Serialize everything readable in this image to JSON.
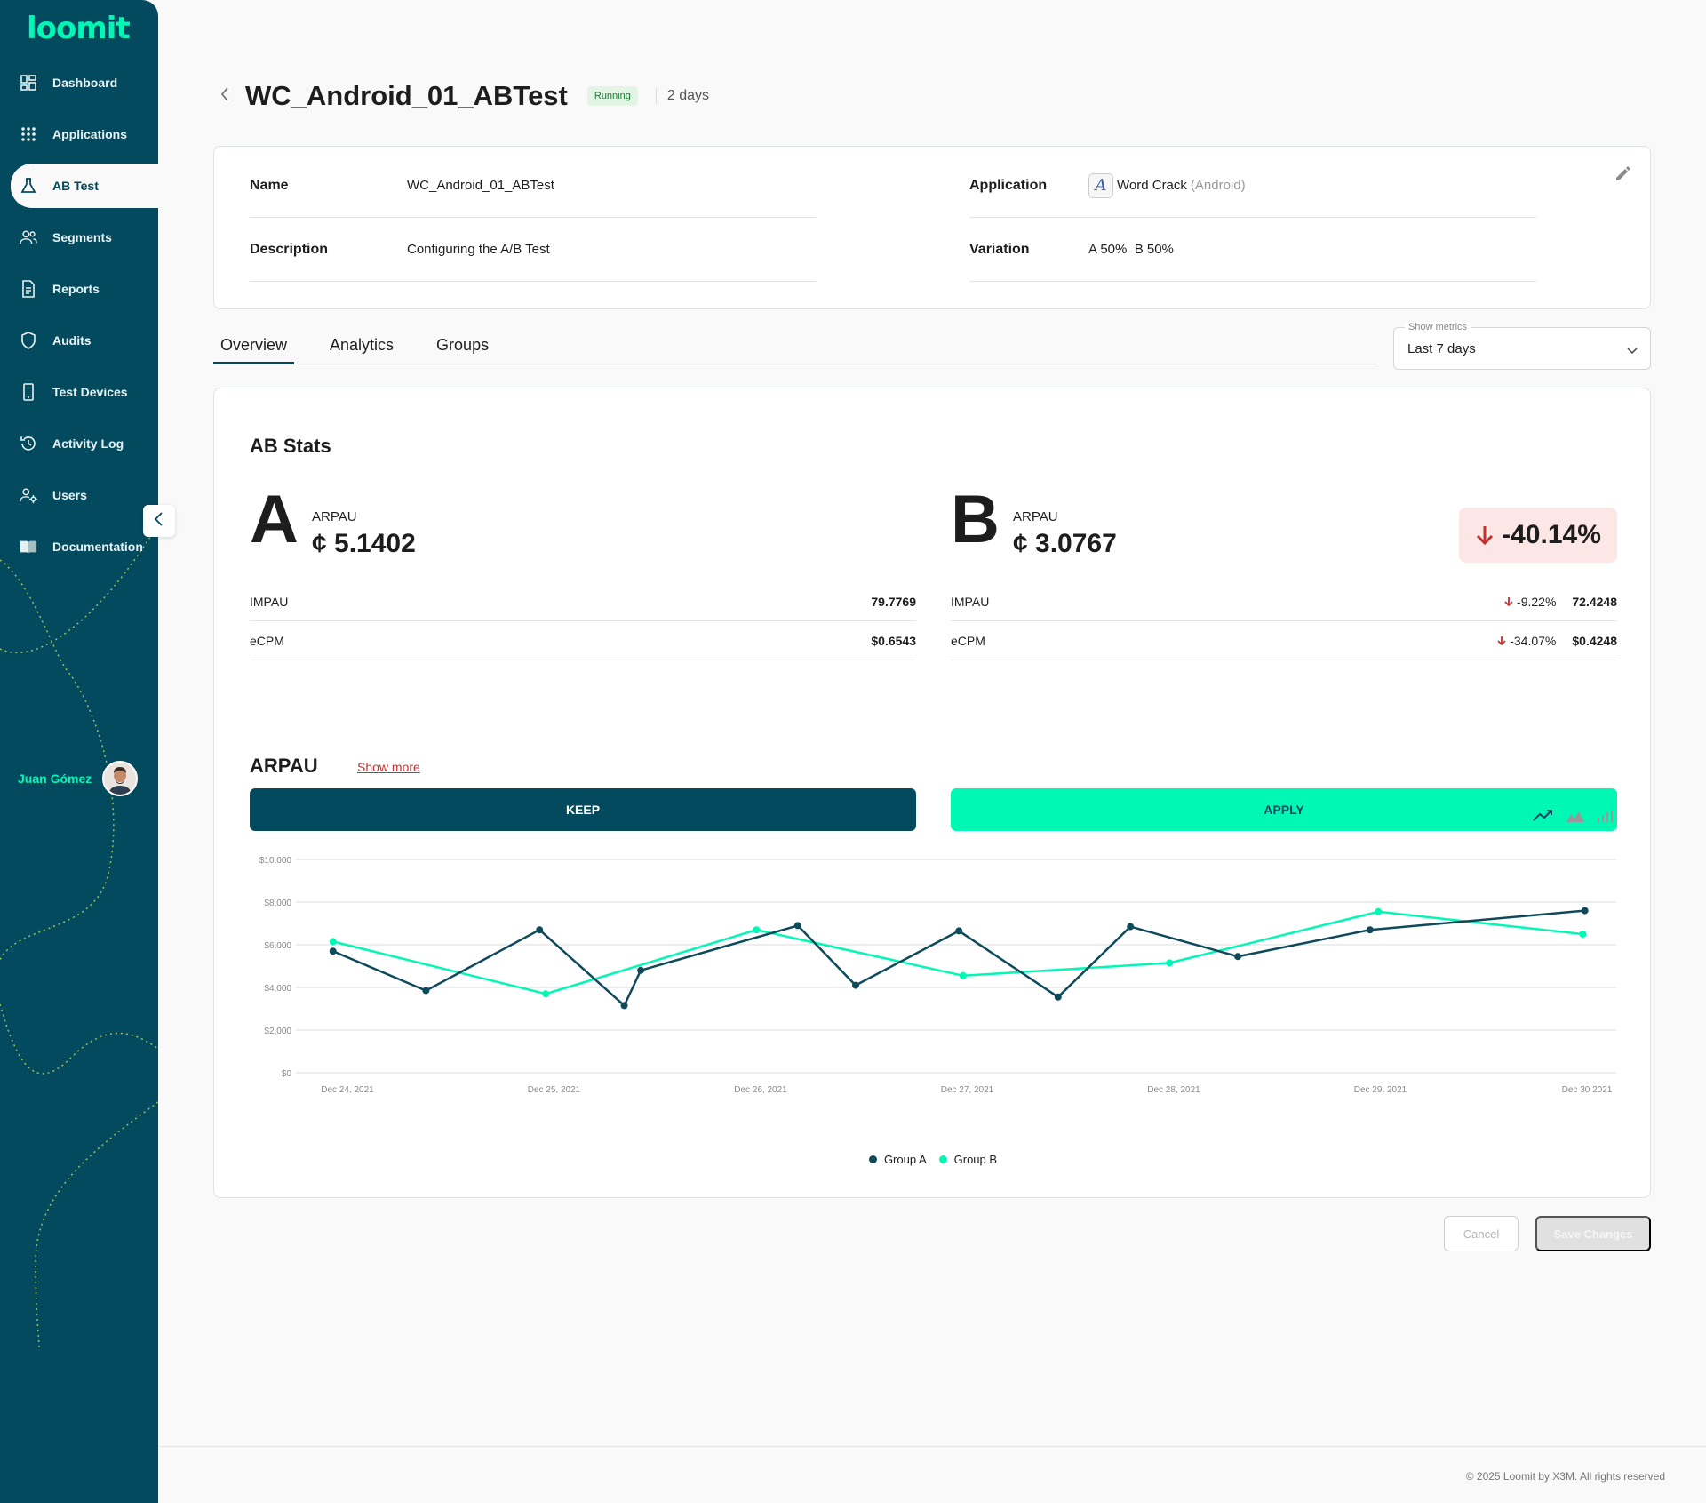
{
  "app": {
    "logo": "loomit"
  },
  "sidebar": {
    "items": [
      {
        "label": "Dashboard",
        "icon": "dashboard-icon"
      },
      {
        "label": "Applications",
        "icon": "apps-grid-icon"
      },
      {
        "label": "AB Test",
        "icon": "flask-icon",
        "active": true
      },
      {
        "label": "Segments",
        "icon": "users-group-icon"
      },
      {
        "label": "Reports",
        "icon": "document-icon"
      },
      {
        "label": "Audits",
        "icon": "shield-icon"
      },
      {
        "label": "Test Devices",
        "icon": "phone-icon"
      },
      {
        "label": "Activity Log",
        "icon": "history-icon"
      },
      {
        "label": "Users",
        "icon": "user-settings-icon"
      },
      {
        "label": "Documentation",
        "icon": "book-icon"
      }
    ],
    "user": {
      "name": "Juan Gómez"
    },
    "colors": {
      "background": "#044a5f",
      "accent": "#00f7b4"
    }
  },
  "header": {
    "title": "WC_Android_01_ABTest",
    "status": "Running",
    "duration": "2 days"
  },
  "info": {
    "name_label": "Name",
    "name_value": "WC_Android_01_ABTest",
    "description_label": "Description",
    "description_value": "Configuring the A/B Test",
    "application_label": "Application",
    "application_name": "Word Crack",
    "application_platform": "(Android)",
    "variation_label": "Variation",
    "variation_value": "A 50%  B 50%"
  },
  "tabs": [
    "Overview",
    "Analytics",
    "Groups"
  ],
  "metrics_select": {
    "label": "Show metrics",
    "value": "Last 7 days"
  },
  "stats": {
    "title": "AB Stats",
    "group_a": {
      "letter": "A",
      "arpau_label": "ARPAU",
      "arpau_value": "¢ 5.1402",
      "metrics": [
        {
          "label": "IMPAU",
          "value": "79.7769"
        },
        {
          "label": "eCPM",
          "value": "$0.6543"
        }
      ],
      "button": "KEEP"
    },
    "group_b": {
      "letter": "B",
      "arpau_label": "ARPAU",
      "arpau_value": "¢ 3.0767",
      "delta": "-40.14%",
      "metrics": [
        {
          "label": "IMPAU",
          "delta": "-9.22%",
          "value": "72.4248"
        },
        {
          "label": "eCPM",
          "delta": "-34.07%",
          "value": "$0.4248"
        }
      ],
      "button": "APPLY"
    },
    "colors": {
      "down": "#c53030",
      "down_bg": "#fce6e6"
    }
  },
  "chart_section": {
    "title": "ARPAU",
    "show_more": "Show more"
  },
  "chart_data": {
    "type": "line",
    "title": "ARPAU",
    "xlabel": "",
    "ylabel": "",
    "ylim": [
      0,
      10000
    ],
    "y_ticks": [
      "$0",
      "$2,000",
      "$4,000",
      "$6,000",
      "$8,000",
      "$10,000"
    ],
    "x_ticks": [
      "Dec 24, 2021",
      "Dec 25, 2021",
      "Dec 26, 2021",
      "Dec 27, 2021",
      "Dec 28, 2021",
      "Dec 29, 2021",
      "Dec 30 2021"
    ],
    "x_range": [
      0,
      6
    ],
    "grid": true,
    "legend_position": "bottom",
    "series": [
      {
        "name": "Group A",
        "color": "#0f4a5c",
        "points": [
          [
            -0.07,
            5700
          ],
          [
            0.38,
            3850
          ],
          [
            0.93,
            6700
          ],
          [
            1.34,
            3150
          ],
          [
            1.42,
            4800
          ],
          [
            2.18,
            6900
          ],
          [
            2.46,
            4100
          ],
          [
            2.96,
            6650
          ],
          [
            3.44,
            3550
          ],
          [
            3.79,
            6850
          ],
          [
            4.31,
            5450
          ],
          [
            4.95,
            6700
          ],
          [
            5.99,
            7600
          ]
        ]
      },
      {
        "name": "Group B",
        "color": "#00f7b4",
        "points": [
          [
            -0.07,
            6150
          ],
          [
            0.96,
            3700
          ],
          [
            1.98,
            6700
          ],
          [
            2.98,
            4550
          ],
          [
            3.98,
            5150
          ],
          [
            4.99,
            7550
          ],
          [
            5.98,
            6500
          ]
        ]
      }
    ]
  },
  "actions": {
    "cancel": "Cancel",
    "save": "Save Changes"
  },
  "footer": {
    "copyright": "© 2025 Loomit by X3M. All rights reserved"
  }
}
